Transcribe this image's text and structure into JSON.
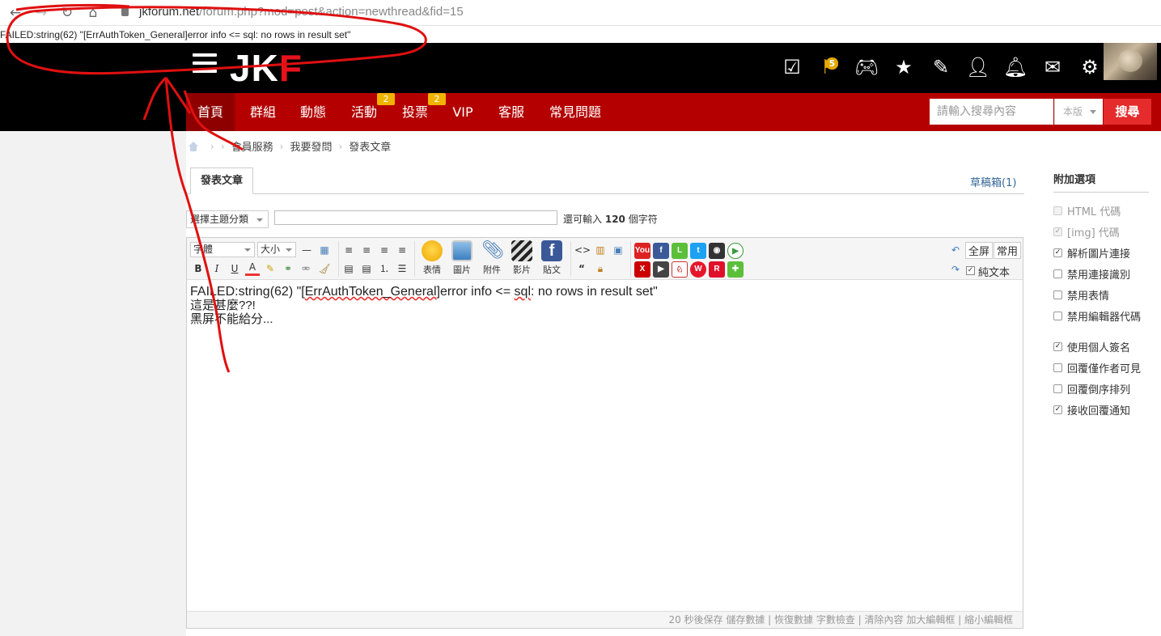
{
  "browser": {
    "url_host": "jkforum.net",
    "url_path": "/forum.php?mod=post&action=newthread&fid=15"
  },
  "error_message": "FAILED:string(62) \"[ErrAuthToken_General]error info <= sql: no rows in result set\"",
  "header": {
    "logo_text": "JK",
    "logo_f": "F",
    "flag_badge": "5",
    "icons": [
      "checkbox-icon",
      "flag-icon",
      "gamepad-icon",
      "star-icon",
      "edit-icon",
      "add-user-icon",
      "bell-icon",
      "mail-icon",
      "gear-icon"
    ]
  },
  "nav": {
    "items": [
      {
        "label": "首頁"
      },
      {
        "label": "群組"
      },
      {
        "label": "動態"
      },
      {
        "label": "活動",
        "badge": "2"
      },
      {
        "label": "投票",
        "badge": "2"
      },
      {
        "label": "VIP"
      },
      {
        "label": "客服"
      },
      {
        "label": "常見問題"
      }
    ],
    "search_placeholder": "請輸入搜尋內容",
    "search_scope": "本版",
    "search_button": "搜尋"
  },
  "breadcrumb": [
    "會員服務",
    "我要發問",
    "發表文章"
  ],
  "tabs": {
    "active": "發表文章",
    "drafts": "草稿箱(1)"
  },
  "subject": {
    "category": "選擇主題分類",
    "char_prefix": "還可輸入",
    "char_count": "120",
    "char_suffix": "個字符"
  },
  "toolbar": {
    "font": "字體",
    "size": "大小",
    "emoticon": "表情",
    "image": "圖片",
    "attach": "附件",
    "video": "影片",
    "post": "貼文",
    "fullscreen": "全屏",
    "common": "常用",
    "plaintext": "純文本"
  },
  "editor": {
    "line1_a": "FAILED:string(62) \"[",
    "line1_spell": "ErrAuthToken_General",
    "line1_b": "]error info <= ",
    "line1_sql": "sql",
    "line1_c": ": no rows in result set\"",
    "line2": "這是甚麼??!",
    "line3": "黑屏不能給分..."
  },
  "footer": {
    "text": "20 秒後保存 儲存數據 | 恢復數據    字數檢查 | 清除內容    加大編輯框 | 縮小編輯框"
  },
  "sidebar": {
    "title": "附加選項",
    "options": [
      {
        "label": "HTML 代碼",
        "checked": false,
        "disabled": true
      },
      {
        "label": "[img] 代碼",
        "checked": true,
        "disabled": true
      },
      {
        "label": "解析圖片連接",
        "checked": true,
        "disabled": false
      },
      {
        "label": "禁用連接識別",
        "checked": false,
        "disabled": false
      },
      {
        "label": "禁用表情",
        "checked": false,
        "disabled": false
      },
      {
        "label": "禁用編輯器代碼",
        "checked": false,
        "disabled": false
      },
      {
        "label": "使用個人簽名",
        "checked": true,
        "disabled": false
      },
      {
        "label": "回覆僅作者可見",
        "checked": false,
        "disabled": false
      },
      {
        "label": "回覆倒序排列",
        "checked": false,
        "disabled": false
      },
      {
        "label": "接收回覆通知",
        "checked": true,
        "disabled": false
      }
    ]
  },
  "colors": {
    "nav_red": "#b40000",
    "header_black": "#000000",
    "badge_yellow": "#f0b400",
    "search_button": "#e52b2b",
    "annotation_red": "#e01010"
  }
}
